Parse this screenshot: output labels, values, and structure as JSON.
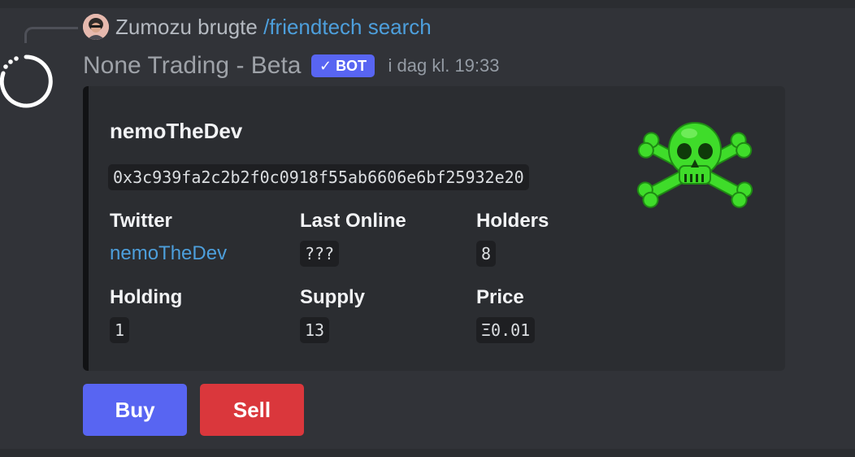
{
  "reply": {
    "username": "Zumozu",
    "verb": " brugte ",
    "command": "/friendtech search"
  },
  "message": {
    "author": "None Trading - Beta",
    "badge": "BOT",
    "timestamp": "i dag kl. 19:33"
  },
  "embed": {
    "title": "nemoTheDev",
    "address": "0x3c939fa2c2b2f0c0918f55ab6606e6bf25932e20",
    "fields": {
      "twitter": {
        "name": "Twitter",
        "value": "nemoTheDev"
      },
      "last_online": {
        "name": "Last Online",
        "value": "???"
      },
      "holders": {
        "name": "Holders",
        "value": "8"
      },
      "holding": {
        "name": "Holding",
        "value": "1"
      },
      "supply": {
        "name": "Supply",
        "value": "13"
      },
      "price": {
        "name": "Price",
        "value": "Ξ0.01"
      }
    },
    "thumbnail": "green-skull-crossbones-image"
  },
  "buttons": {
    "buy": "Buy",
    "sell": "Sell"
  },
  "colors": {
    "background": "#313338",
    "embed_bg": "#2b2d31",
    "link": "#4d9fdc",
    "blurple": "#5865f2",
    "danger": "#da373c",
    "skull_green": "#3fdc2a"
  }
}
